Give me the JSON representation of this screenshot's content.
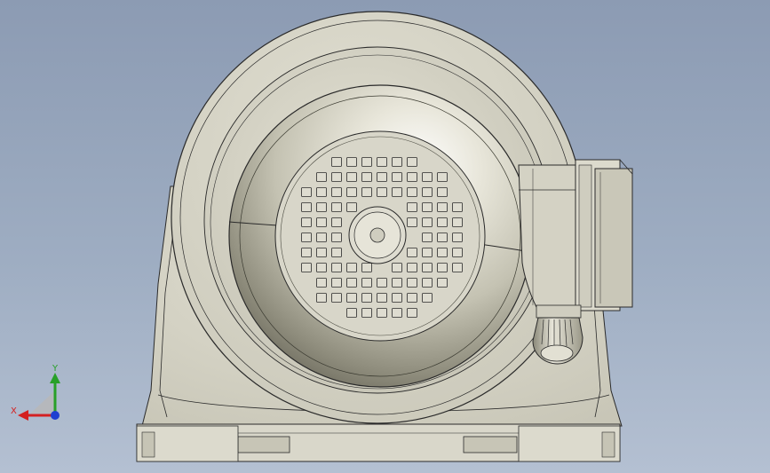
{
  "view": {
    "name": "CAD 3D viewport",
    "background_top": "#8c9bb3",
    "background_bottom": "#b4c0d2"
  },
  "model": {
    "description_icon": "motor-front-view",
    "body_color": "#d6d4c6",
    "shade_color": "#b9b7a8",
    "edge_color": "#2a2a2a"
  },
  "triad": {
    "x_label": "X",
    "y_label": "Y",
    "x_color": "#d42020",
    "y_color": "#28a028",
    "z_color": "#2040d0"
  }
}
